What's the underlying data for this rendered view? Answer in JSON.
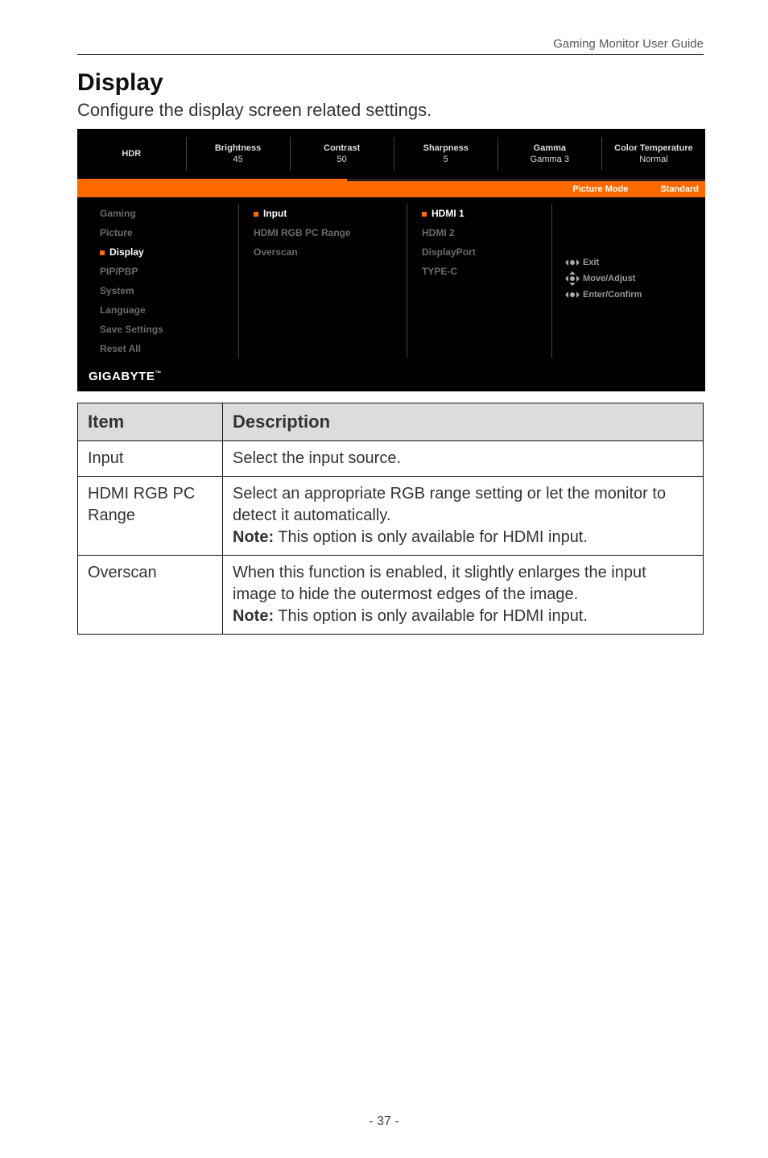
{
  "header": {
    "title": "Gaming Monitor User Guide"
  },
  "section": {
    "heading": "Display",
    "subtitle": "Configure the display screen related settings."
  },
  "osd": {
    "top": [
      {
        "label": "HDR",
        "value": ""
      },
      {
        "label": "Brightness",
        "value": "45"
      },
      {
        "label": "Contrast",
        "value": "50"
      },
      {
        "label": "Sharpness",
        "value": "5"
      },
      {
        "label": "Gamma",
        "value": "Gamma 3"
      },
      {
        "label": "Color Temperature",
        "value": "Normal"
      }
    ],
    "strip": {
      "left": "Picture Mode",
      "right": "Standard"
    },
    "left_menu": [
      {
        "label": "Gaming",
        "active": false
      },
      {
        "label": "Picture",
        "active": false
      },
      {
        "label": "Display",
        "active": true
      },
      {
        "label": "PIP/PBP",
        "active": false
      },
      {
        "label": "System",
        "active": false
      },
      {
        "label": "Language",
        "active": false
      },
      {
        "label": "Save Settings",
        "active": false
      },
      {
        "label": "Reset All",
        "active": false
      }
    ],
    "mid_menu": [
      {
        "label": "Input",
        "selected": true
      },
      {
        "label": "HDMI RGB PC Range",
        "selected": false
      },
      {
        "label": "Overscan",
        "selected": false
      }
    ],
    "right_menu": [
      {
        "label": "HDMI 1",
        "selected": true
      },
      {
        "label": "HDMI 2",
        "selected": false
      },
      {
        "label": "DisplayPort",
        "selected": false
      },
      {
        "label": "TYPE-C",
        "selected": false
      }
    ],
    "hints": {
      "exit": "Exit",
      "move": "Move/Adjust",
      "enter": "Enter/Confirm"
    },
    "logo": "GIGABYTE"
  },
  "table": {
    "headers": {
      "item": "Item",
      "desc": "Description"
    },
    "rows": [
      {
        "item": "Input",
        "desc": "Select the input source."
      },
      {
        "item": "HDMI RGB PC Range",
        "desc_line1": "Select an appropriate RGB range setting or let the monitor to detect it automatically.",
        "note_label": "Note:",
        "note_text": " This option is only available for HDMI input."
      },
      {
        "item": "Overscan",
        "desc_line1": "When this function is enabled, it slightly enlarges the input image to hide the outermost edges of the image.",
        "note_label": "Note:",
        "note_text": " This option is only available for HDMI input."
      }
    ]
  },
  "footer": {
    "page": "- 37 -"
  }
}
